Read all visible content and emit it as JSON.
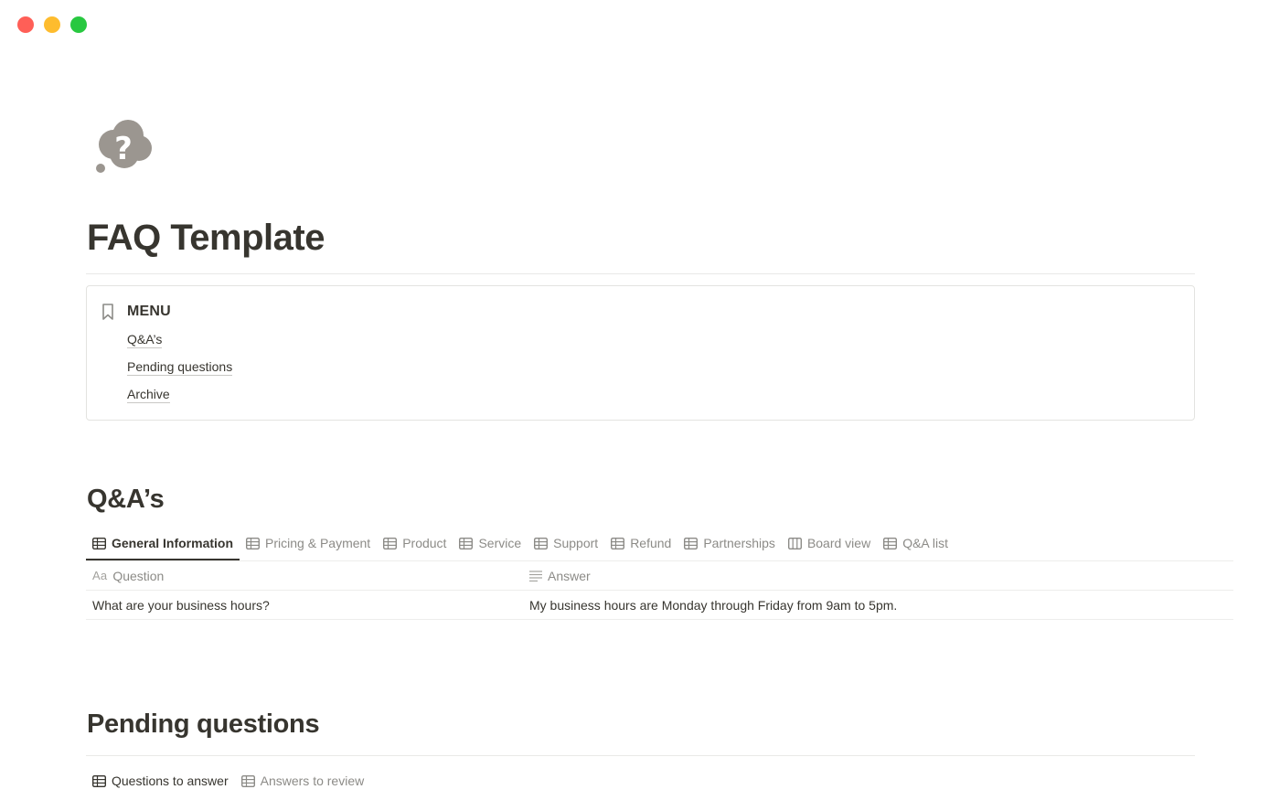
{
  "page": {
    "icon": "question-thought-bubble-icon",
    "title": "FAQ Template"
  },
  "menu": {
    "icon": "bookmark-icon",
    "title": "MENU",
    "links": [
      "Q&A’s",
      "Pending questions",
      "Archive"
    ]
  },
  "qa_section": {
    "heading": "Q&A’s",
    "tabs": [
      {
        "label": "General Information",
        "icon": "table-icon",
        "active": true
      },
      {
        "label": "Pricing & Payment",
        "icon": "table-icon",
        "active": false
      },
      {
        "label": "Product",
        "icon": "table-icon",
        "active": false
      },
      {
        "label": "Service",
        "icon": "table-icon",
        "active": false
      },
      {
        "label": "Support",
        "icon": "table-icon",
        "active": false
      },
      {
        "label": "Refund",
        "icon": "table-icon",
        "active": false
      },
      {
        "label": "Partnerships",
        "icon": "table-icon",
        "active": false
      },
      {
        "label": "Board view",
        "icon": "board-icon",
        "active": false
      },
      {
        "label": "Q&A list",
        "icon": "table-icon",
        "active": false
      }
    ],
    "table": {
      "columns": [
        {
          "label": "Question",
          "prefix": "Aa",
          "icon": "title-property-icon"
        },
        {
          "label": "Answer",
          "icon": "text-lines-icon"
        }
      ],
      "rows": [
        [
          "What are your business hours?",
          "My business hours are Monday through Friday from 9am to 5pm."
        ]
      ]
    }
  },
  "pending_section": {
    "heading": "Pending questions",
    "tabs": [
      {
        "label": "Questions to answer",
        "icon": "table-icon",
        "active": true
      },
      {
        "label": "Answers to review",
        "icon": "table-icon",
        "active": false
      }
    ]
  },
  "colors": {
    "traffic_red": "#ff5f57",
    "traffic_yellow": "#febc2e",
    "traffic_green": "#28c840",
    "text": "#37352f",
    "muted": "#8c8b87",
    "icon_gray": "#9b9690"
  }
}
